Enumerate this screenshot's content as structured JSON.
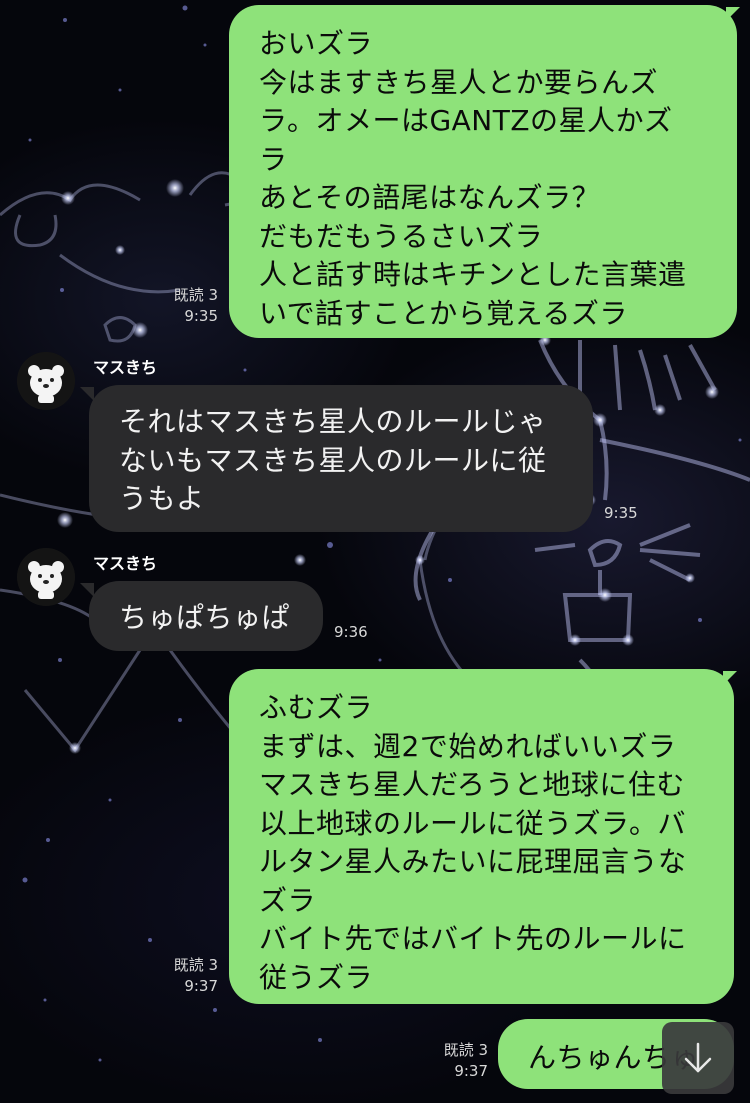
{
  "messages": [
    {
      "id": "m1",
      "direction": "out",
      "lines": [
        "おいズラ",
        "今はますきち星人とか要らんズ",
        "ラ。オメーはGANTZの星人かズ",
        "ラ",
        "あとその語尾はなんズラ？",
        "だもだもうるさいズラ",
        "人と話す時はキチンとした言葉遣",
        "いで話すことから覚えるズラ"
      ],
      "read_label": "既読 3",
      "time": "9:35"
    },
    {
      "id": "m2",
      "direction": "in",
      "sender": "マスきち",
      "lines": [
        "それはマスきち星人のルールじゃ",
        "ないもマスきち星人のルールに従",
        "うもよ"
      ],
      "time": "9:35"
    },
    {
      "id": "m3",
      "direction": "in",
      "sender": "マスきち",
      "lines": [
        "ちゅぱちゅぱ"
      ],
      "time": "9:36"
    },
    {
      "id": "m4",
      "direction": "out",
      "lines": [
        "ふむズラ",
        "まずは、週2で始めればいいズラ",
        "マスきち星人だろうと地球に住む",
        "以上地球のルールに従うズラ。バ",
        "ルタン星人みたいに屁理屈言うな",
        "ズラ",
        "バイト先ではバイト先のルールに",
        "従うズラ"
      ],
      "read_label": "既読 3",
      "time": "9:37"
    },
    {
      "id": "m5",
      "direction": "out",
      "lines": [
        "んちゅんちゅ"
      ],
      "read_label": "既読 3",
      "time": "9:37"
    }
  ],
  "icons": {
    "avatar": "bear-avatar-icon",
    "scroll": "arrow-down-icon"
  },
  "colors": {
    "outgoing_bubble": "#8ee27a",
    "incoming_bubble": "#2a2a2c",
    "background": "#05060c",
    "meta_text": "#d8d8d8"
  }
}
